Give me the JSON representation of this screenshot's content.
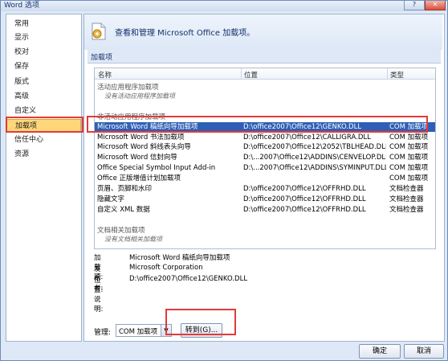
{
  "window": {
    "title": "Word 选项",
    "help_glyph": "?",
    "close_glyph": "✕"
  },
  "sidebar": {
    "items": [
      {
        "label": "常用"
      },
      {
        "label": "显示"
      },
      {
        "label": "校对"
      },
      {
        "label": "保存"
      },
      {
        "label": "版式"
      },
      {
        "label": "高级"
      },
      {
        "label": "自定义"
      },
      {
        "label": "加载项"
      },
      {
        "label": "信任中心"
      },
      {
        "label": "资源"
      }
    ],
    "active_index": 7
  },
  "header": {
    "text": "查看和管理 Microsoft Office 加载项。",
    "icon": "addins-gear-icon"
  },
  "section": {
    "title": "加载项"
  },
  "table": {
    "columns": [
      "名称",
      "位置",
      "类型"
    ],
    "groups": {
      "active": {
        "title": "活动应用程序加载项",
        "empty_note": "没有活动应用程序加载项"
      },
      "inactive": {
        "title": "非活动应用程序加载项"
      },
      "document": {
        "title": "文档相关加载项",
        "empty_note": "没有文档相关加载项"
      }
    },
    "rows": [
      {
        "name": "Microsoft Word 稿纸向导加载项",
        "location": "D:\\office2007\\Office12\\GENKO.DLL",
        "type": "COM 加载项",
        "selected": true
      },
      {
        "name": "Microsoft Word 书法加载项",
        "location": "D:\\office2007\\Office12\\CALLIGRA.DLL",
        "type": "COM 加载项"
      },
      {
        "name": "Microsoft Word 斜线表头向导",
        "location": "D:\\office2007\\Office12\\2052\\TBLHEAD.DLL",
        "type": "COM 加载项"
      },
      {
        "name": "Microsoft Word 信封向导",
        "location": "D:\\...2007\\Office12\\ADDINS\\CENVELOP.DLL",
        "type": "COM 加载项"
      },
      {
        "name": "Office Special Symbol Input Add-in",
        "location": "D:\\...2007\\Office12\\ADDINS\\SYMINPUT.DLL",
        "type": "COM 加载项"
      },
      {
        "name": "Office 正版增值计划加载项",
        "location": "",
        "type": "COM 加载项"
      },
      {
        "name": "页眉、页脚和水印",
        "location": "D:\\office2007\\Office12\\OFFRHD.DLL",
        "type": "文档检查器"
      },
      {
        "name": "隐藏文字",
        "location": "D:\\office2007\\Office12\\OFFRHD.DLL",
        "type": "文档检查器"
      },
      {
        "name": "自定义 XML 数据",
        "location": "D:\\office2007\\Office12\\OFFRHD.DLL",
        "type": "文档检查器"
      }
    ]
  },
  "details": {
    "addin_label": "加载项:",
    "addin_value": "Microsoft Word 稿纸向导加载项",
    "publisher_label": "发布者:",
    "publisher_value": "Microsoft Corporation",
    "location_label": "位置:",
    "location_value": "D:\\office2007\\Office12\\GENKO.DLL",
    "desc_label": "说明:"
  },
  "manage": {
    "label": "管理:",
    "value": "COM 加载项",
    "goto_label": "转到(G)..."
  },
  "footer": {
    "ok_label": "确定",
    "cancel_label": "取消"
  },
  "colors": {
    "selection": "#2e5fb6",
    "highlight_box": "#e23a3a",
    "active_nav": "#ffd77a"
  }
}
